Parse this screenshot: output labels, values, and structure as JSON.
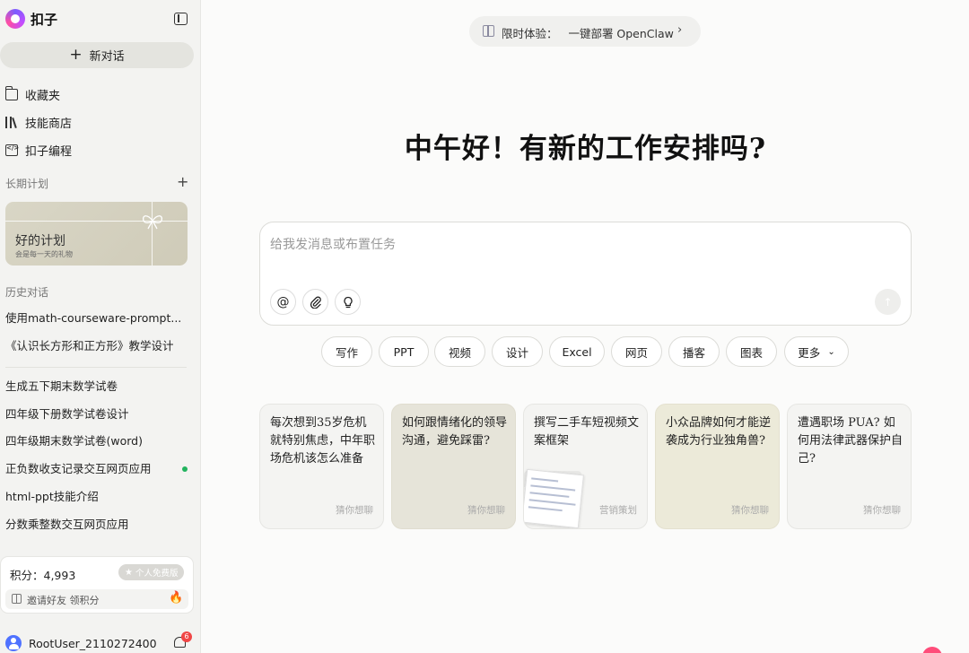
{
  "brand": {
    "name": "扣子"
  },
  "sidebar": {
    "new_chat_label": "新对话",
    "nav": [
      {
        "label": "收藏夹",
        "icon": "folder-icon"
      },
      {
        "label": "技能商店",
        "icon": "books-icon"
      },
      {
        "label": "扣子编程",
        "icon": "code-file-icon"
      }
    ],
    "plans": {
      "section_label": "长期计划",
      "card_title": "好的计划",
      "card_subtitle": "会是每一天的礼物"
    },
    "history": {
      "section_label": "历史对话",
      "items": [
        "使用math-courseware-prompt...",
        "《认识长方形和正方形》教学设计",
        "生成五下期末数学试卷",
        "四年级下册数学试卷设计",
        "四年级期末数学试卷(word)",
        "正负数收支记录交互网页应用",
        "html-ppt技能介绍",
        "分数乘整数交互网页应用"
      ]
    },
    "points": {
      "label": "积分：4,993",
      "badge": "个人免费版",
      "invite": "邀请好友 领积分"
    },
    "user": {
      "name": "RootUser_2110272400",
      "notifications": "6"
    }
  },
  "main": {
    "promo": {
      "label": "限时体验：",
      "text": "一键部署 OpenClaw"
    },
    "greeting": "中午好！有新的工作安排吗?",
    "input": {
      "placeholder": "给我发消息或布置任务",
      "value": ""
    },
    "chips": [
      "写作",
      "PPT",
      "视频",
      "设计",
      "Excel",
      "网页",
      "播客",
      "图表",
      "更多"
    ],
    "cards": [
      {
        "text": "每次想到35岁危机就特别焦虑，中年职场危机该怎么准备",
        "tag": "猜你想聊"
      },
      {
        "text": "如何跟情绪化的领导沟通，避免踩雷?",
        "tag": "猜你想聊"
      },
      {
        "text": "撰写二手车短视频文案框架",
        "tag": "营销策划"
      },
      {
        "text": "小众品牌如何才能逆袭成为行业独角兽?",
        "tag": "猜你想聊"
      },
      {
        "text": "遭遇职场 PUA? 如何用法律武器保护自己?",
        "tag": "猜你想聊"
      }
    ]
  },
  "colors": {
    "sidebar_bg": "#f3f3f1",
    "main_bg": "#fbfbfa",
    "card_beige": "#e6e4d9",
    "status_green": "#22b35e",
    "badge_red": "#f04646",
    "avatar_blue": "#4f72ff"
  }
}
